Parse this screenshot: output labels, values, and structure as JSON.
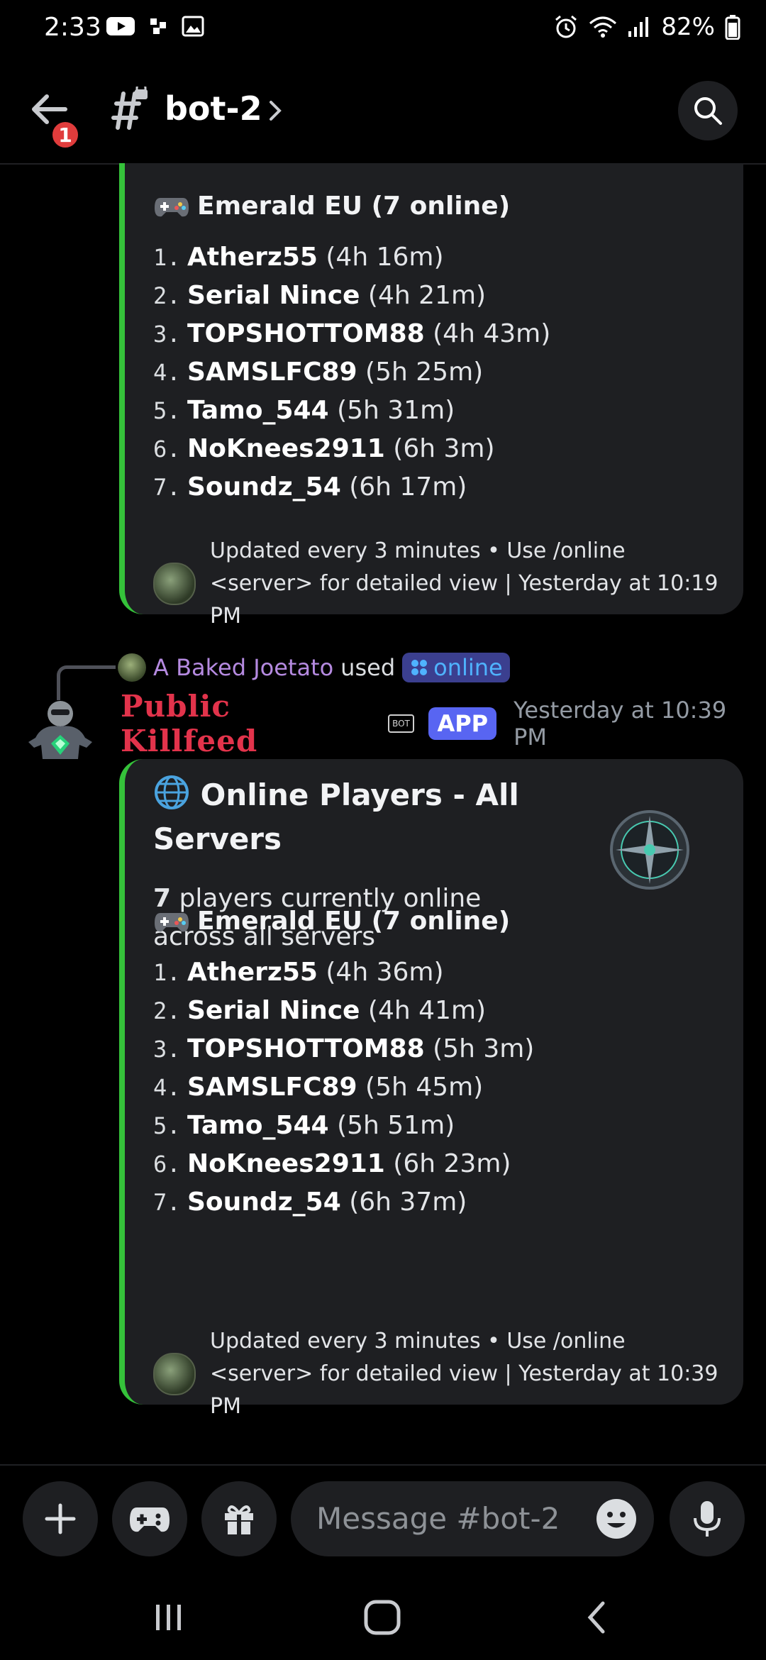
{
  "status_bar": {
    "time": "2:33",
    "battery": "82%"
  },
  "header": {
    "notification_count": "1",
    "channel_name": "bot-2"
  },
  "embed_top": {
    "server_heading": "Emerald EU (7 online)",
    "players": [
      {
        "num": "1.",
        "name": "Atherz55",
        "time": "(4h 16m)"
      },
      {
        "num": "2.",
        "name": "Serial Nince",
        "time": "(4h 21m)"
      },
      {
        "num": "3.",
        "name": "TOPSHOTTOM88",
        "time": "(4h 43m)"
      },
      {
        "num": "4.",
        "name": "SAMSLFC89",
        "time": "(5h 25m)"
      },
      {
        "num": "5.",
        "name": "Tamo_544",
        "time": "(5h 31m)"
      },
      {
        "num": "6.",
        "name": "NoKnees2911",
        "time": "(6h 3m)"
      },
      {
        "num": "7.",
        "name": "Soundz_54",
        "time": "(6h 17m)"
      }
    ],
    "footer": "Updated every 3 minutes • Use /online <server> for detailed view | Yesterday at 10:19 PM"
  },
  "reply": {
    "user": "A Baked Joetato",
    "used": "used",
    "command": "online"
  },
  "message": {
    "author": "Public Killfeed",
    "bot_tag": "BOT",
    "app_tag": "APP",
    "timestamp": "Yesterday at 10:39 PM"
  },
  "embed_main": {
    "title": "Online Players - All Servers",
    "count": "7",
    "desc_rest": "players currently online across all servers",
    "server_heading": "Emerald EU (7 online)",
    "players": [
      {
        "num": "1.",
        "name": "Atherz55",
        "time": "(4h 36m)"
      },
      {
        "num": "2.",
        "name": "Serial Nince",
        "time": "(4h 41m)"
      },
      {
        "num": "3.",
        "name": "TOPSHOTTOM88",
        "time": "(5h 3m)"
      },
      {
        "num": "4.",
        "name": "SAMSLFC89",
        "time": "(5h 45m)"
      },
      {
        "num": "5.",
        "name": "Tamo_544",
        "time": "(5h 51m)"
      },
      {
        "num": "6.",
        "name": "NoKnees2911",
        "time": "(6h 23m)"
      },
      {
        "num": "7.",
        "name": "Soundz_54",
        "time": "(6h 37m)"
      }
    ],
    "footer": "Updated every 3 minutes • Use /online <server> for detailed view | Yesterday at 10:39 PM"
  },
  "composer": {
    "placeholder": "Message #bot-2"
  },
  "colors": {
    "embed_accent": "#35c23a",
    "author_name": "#e2334b",
    "app_tag": "#5865f2",
    "reply_user": "#b58ae0",
    "badge": "#e03c3c"
  }
}
